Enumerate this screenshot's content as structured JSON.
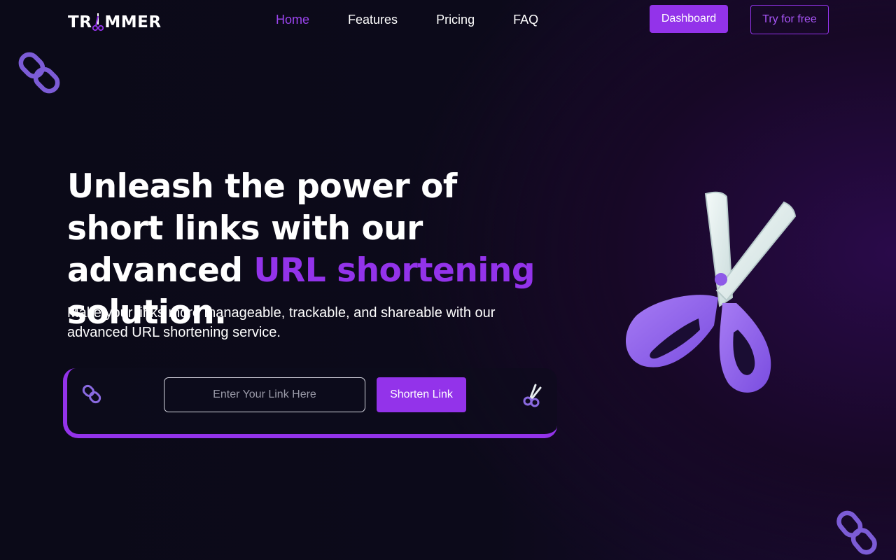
{
  "brand": {
    "logo_left": "TR",
    "logo_right": "MMER",
    "accent_color": "#9333ea"
  },
  "nav": {
    "items": [
      {
        "label": "Home",
        "active": true
      },
      {
        "label": "Features",
        "active": false
      },
      {
        "label": "Pricing",
        "active": false
      },
      {
        "label": "FAQ",
        "active": false
      }
    ]
  },
  "header": {
    "dashboard_label": "Dashboard",
    "try_label": "Try for free"
  },
  "hero": {
    "title_part1": "Unleash the power of short links with our advanced ",
    "title_accent": "URL shortening",
    "title_part2": " solution.",
    "subtitle": "Make your links more manageable, trackable, and shareable with our advanced URL shortening service."
  },
  "shortener": {
    "input_value": "",
    "input_placeholder": "Enter Your Link Here",
    "button_label": "Shorten Link"
  },
  "icons": {
    "logo_mark": "scissors-icon",
    "hero_image": "scissors-illustration",
    "decorations": [
      "chain-link-icon",
      "chain-link-icon",
      "scissors-icon",
      "chain-link-icon"
    ]
  }
}
